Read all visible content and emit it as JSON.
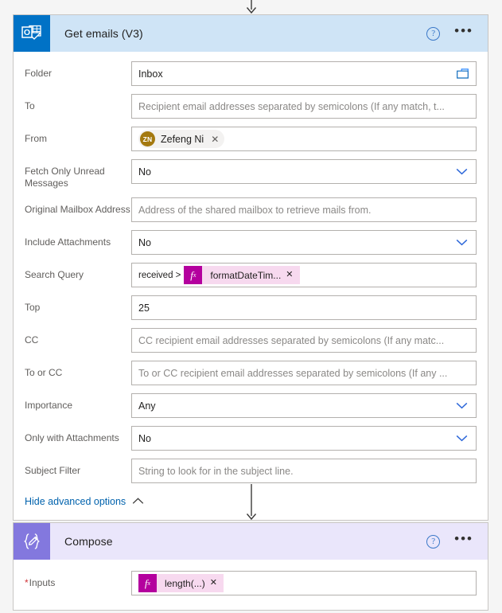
{
  "connectors": [
    {
      "name": "arrow-top"
    },
    {
      "name": "arrow-between-cards"
    }
  ],
  "cards": [
    {
      "id": "get-emails",
      "title": "Get emails (V3)",
      "icon": "outlook-icon",
      "help_label": "?",
      "more_label": "•••",
      "fields": [
        {
          "label": "Folder",
          "name": "folder",
          "type": "text-with-picker",
          "value": "Inbox",
          "trailing_icon": "folder-picker-icon"
        },
        {
          "label": "To",
          "name": "to",
          "type": "text",
          "placeholder": "Recipient email addresses separated by semicolons (If any match, t..."
        },
        {
          "label": "From",
          "name": "from",
          "type": "person-chip",
          "chip": {
            "initials": "ZN",
            "display_name": "Zefeng Ni",
            "remove_label": "✕"
          }
        },
        {
          "label": "Fetch Only Unread Messages",
          "name": "fetch-only-unread-messages",
          "type": "dropdown",
          "value": "No"
        },
        {
          "label": "Original Mailbox Address",
          "name": "original-mailbox-address",
          "type": "text",
          "placeholder": "Address of the shared mailbox to retrieve mails from."
        },
        {
          "label": "Include Attachments",
          "name": "include-attachments",
          "type": "dropdown",
          "value": "No"
        },
        {
          "label": "Search Query",
          "name": "search-query",
          "type": "expression",
          "static_text": "received >",
          "token": {
            "fx": "fx",
            "text": "formatDateTim...",
            "remove_label": "✕"
          }
        },
        {
          "label": "Top",
          "name": "top",
          "type": "text",
          "value": "25"
        },
        {
          "label": "CC",
          "name": "cc",
          "type": "text",
          "placeholder": "CC recipient email addresses separated by semicolons (If any matc..."
        },
        {
          "label": "To or CC",
          "name": "to-or-cc",
          "type": "text",
          "placeholder": "To or CC recipient email addresses separated by semicolons (If any ..."
        },
        {
          "label": "Importance",
          "name": "importance",
          "type": "dropdown",
          "value": "Any"
        },
        {
          "label": "Only with Attachments",
          "name": "only-with-attachments",
          "type": "dropdown",
          "value": "No"
        },
        {
          "label": "Subject Filter",
          "name": "subject-filter",
          "type": "text",
          "placeholder": "String to look for in the subject line."
        }
      ],
      "advanced_toggle": "Hide advanced options"
    },
    {
      "id": "compose",
      "title": "Compose",
      "icon": "compose-icon",
      "help_label": "?",
      "more_label": "•••",
      "fields": [
        {
          "label": "Inputs",
          "name": "inputs",
          "required": true,
          "required_marker": "*",
          "type": "expression",
          "static_text": "",
          "token": {
            "fx": "fx",
            "text": "length(...)",
            "remove_label": "✕"
          }
        }
      ]
    }
  ],
  "colors": {
    "outlook_header": "#cfe4f6",
    "outlook_tile": "#0072c6",
    "compose_header": "#eae6fb",
    "compose_tile": "#8378de",
    "token_bg": "#f7d9ef",
    "fx_badge": "#b4009e",
    "avatar": "#a4790f",
    "link": "#0062ad",
    "required": "#d13438"
  }
}
